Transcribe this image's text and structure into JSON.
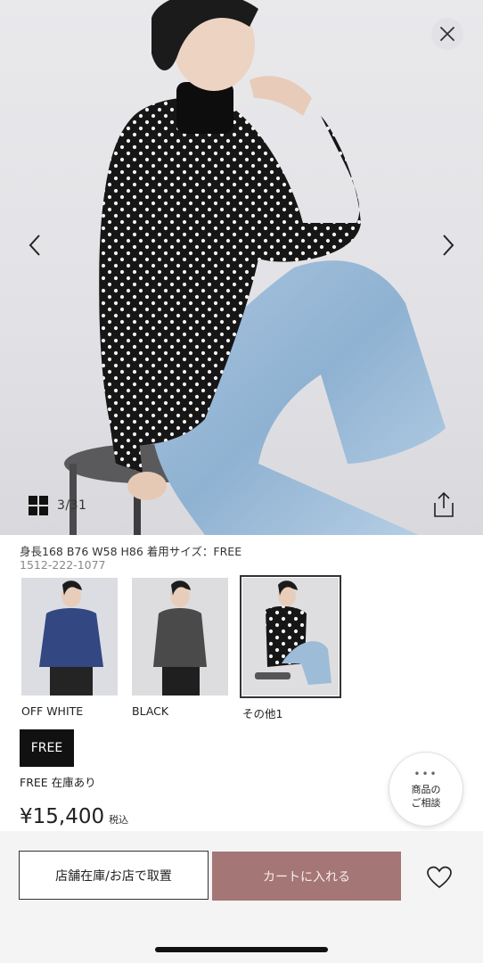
{
  "gallery": {
    "counter": "3/31",
    "icons": {
      "close": "close-icon",
      "prev": "chevron-left-icon",
      "next": "chevron-right-icon",
      "grid": "grid-icon",
      "share": "share-icon"
    }
  },
  "product": {
    "model_info": "身長168 B76 W58 H86 着用サイズ：FREE",
    "code": "1512-222-1077",
    "colors": [
      {
        "label": "OFF WHITE",
        "selected": false
      },
      {
        "label": "BLACK",
        "selected": false
      },
      {
        "label": "その他1",
        "selected": true
      }
    ],
    "size": "FREE",
    "stock": "FREE 在庫あり",
    "price": "¥15,400",
    "tax_label": "税込"
  },
  "consult": {
    "dots": "•••",
    "line1": "商品の",
    "line2": "ご相談"
  },
  "actions": {
    "store_label": "店舗在庫/お店で取置",
    "cart_label": "カートに入れる",
    "favorite_icon": "heart-icon"
  },
  "colors": {
    "cart_button": "#a57676",
    "size_chip": "#111111",
    "bottom_bar": "#f4f4f5"
  }
}
